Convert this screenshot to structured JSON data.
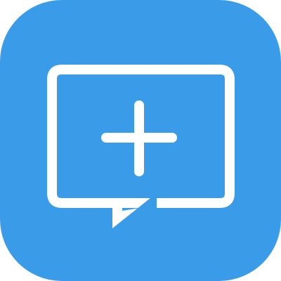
{
  "icon": {
    "name": "new-message-icon",
    "background_color": "#3a9ce8",
    "glyph_color": "#ffffff",
    "glyphs": [
      "speech-bubble-icon",
      "plus-icon"
    ]
  }
}
